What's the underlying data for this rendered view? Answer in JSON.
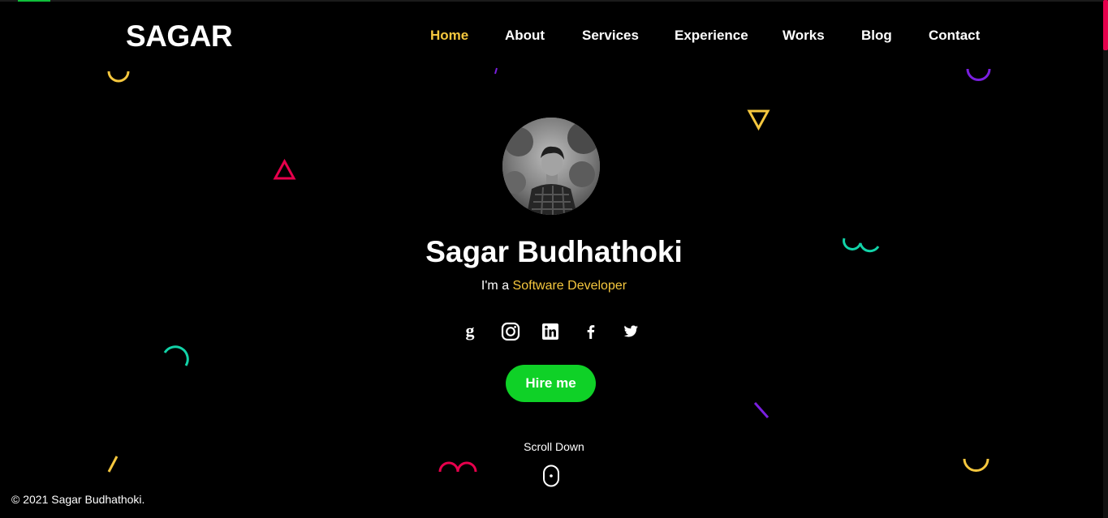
{
  "header": {
    "logo": "SAGAR",
    "nav": [
      {
        "label": "Home",
        "active": true
      },
      {
        "label": "About",
        "active": false
      },
      {
        "label": "Services",
        "active": false
      },
      {
        "label": "Experience",
        "active": false
      },
      {
        "label": "Works",
        "active": false
      },
      {
        "label": "Blog",
        "active": false
      },
      {
        "label": "Contact",
        "active": false
      }
    ]
  },
  "hero": {
    "name": "Sagar Budhathoki",
    "role_prefix": "I'm a",
    "role_highlight": "Software Developer",
    "social": [
      {
        "icon": "goodreads-icon"
      },
      {
        "icon": "instagram-icon"
      },
      {
        "icon": "linkedin-icon"
      },
      {
        "icon": "facebook-icon"
      },
      {
        "icon": "twitter-icon"
      }
    ],
    "hire_label": "Hire me",
    "scroll_label": "Scroll Down"
  },
  "footer": {
    "copyright": "© 2021 Sagar Budhathoki."
  },
  "colors": {
    "background": "#000000",
    "accent_yellow": "#f5c73e",
    "accent_green": "#0fd127",
    "shape_red": "#e6004c",
    "shape_teal": "#12d3a8",
    "shape_purple": "#7a1fe0"
  }
}
